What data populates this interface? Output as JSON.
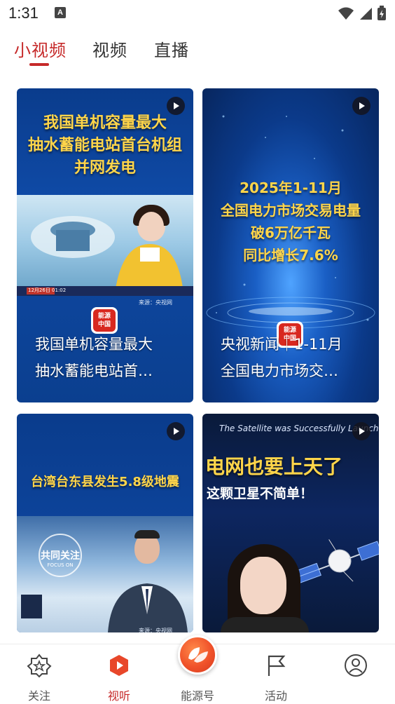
{
  "status_bar": {
    "time": "1:31",
    "notification_icon": "A"
  },
  "top_tabs": [
    {
      "label": "小视频",
      "active": true
    },
    {
      "label": "视频",
      "active": false
    },
    {
      "label": "直播",
      "active": false
    }
  ],
  "cards": [
    {
      "headline_lines": [
        "我国单机容量最大",
        "抽水蓄能电站首台机组",
        "并网发电"
      ],
      "caption_lines": [
        "我国单机容量最大",
        "抽水蓄能电站首…"
      ],
      "source": "来源：央视网",
      "ticker": "12月26日 01:02"
    },
    {
      "headline_lines": [
        "2025年1-11月",
        "全国电力市场交易电量",
        "破6万亿千瓦",
        "同比增长7.6%"
      ],
      "caption_lines": [
        "央视新闻｜1-11月",
        "全国电力市场交…"
      ]
    },
    {
      "headline_lines": [
        "台湾台东县发生5.8级地震"
      ],
      "program": "共同关注",
      "program_en": "FOCUS ON",
      "source": "来源：央视网"
    },
    {
      "banner": "The Satellite was Successfully Launched",
      "headline_lines": [
        "电网也要上天了",
        "这颗卫星不简单！"
      ]
    }
  ],
  "bottom_nav": [
    {
      "label": "关注",
      "icon": "star-badge-icon",
      "active": false
    },
    {
      "label": "视听",
      "icon": "play-icon",
      "active": true
    },
    {
      "label": "能源号",
      "icon": "leaf-logo-icon",
      "active": false
    },
    {
      "label": "活动",
      "icon": "flag-icon",
      "active": false
    },
    {
      "label": "",
      "icon": "profile-icon",
      "active": false
    }
  ],
  "colors": {
    "accent": "#c62a2a",
    "headline": "#ffd54a",
    "fab": "#f0522a"
  }
}
